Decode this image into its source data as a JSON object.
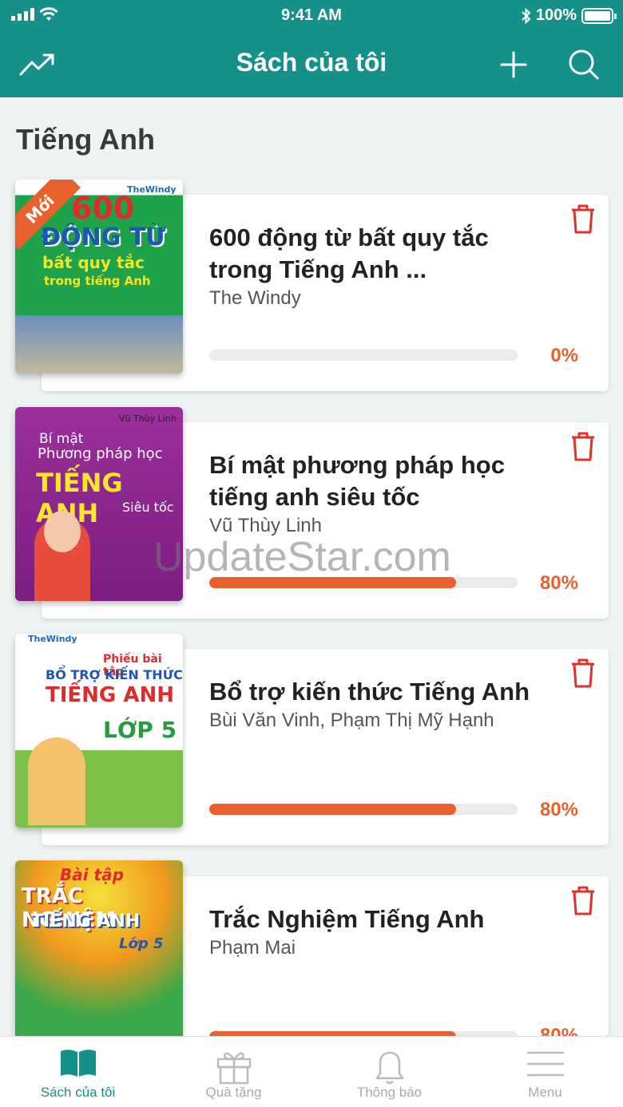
{
  "status": {
    "time": "9:41 AM",
    "battery": "100%"
  },
  "nav": {
    "title": "Sách của tôi"
  },
  "section": {
    "title": "Tiếng Anh"
  },
  "books": [
    {
      "title": "600 động từ bất quy tắc trong Tiếng Anh ...",
      "author": "The Windy",
      "progress": 0,
      "progress_label": "0%",
      "badge": "Mới",
      "cover": {
        "line1": "600",
        "line2": "ĐỘNG TỪ",
        "line3": "bất quy tắc",
        "line4": "trong tiếng Anh",
        "publisher": "TheWindy"
      }
    },
    {
      "title": "Bí mật phương pháp học tiếng anh siêu tốc",
      "author": "Vũ Thùy Linh",
      "progress": 0.8,
      "progress_label": "80%",
      "cover": {
        "line1": "Bí mật",
        "line2": "Phương pháp học",
        "line3": "TIẾNG ANH",
        "line4": "Siêu tốc",
        "publisher": "Vũ Thùy Linh"
      }
    },
    {
      "title": "Bổ trợ kiến thức Tiếng Anh",
      "author": "Bùi Văn Vinh, Phạm Thị Mỹ Hạnh",
      "progress": 0.8,
      "progress_label": "80%",
      "cover": {
        "line1": "Phiếu bài tập",
        "line2": "BỔ TRỢ KIẾN THỨC",
        "line3": "TIẾNG ANH",
        "line4": "LỚP 5",
        "publisher": "TheWindy"
      }
    },
    {
      "title": "Trắc Nghiệm Tiếng Anh",
      "author": "Phạm Mai",
      "progress": 0.8,
      "progress_label": "80%",
      "cover": {
        "line1": "Bài tập",
        "line2": "TRẮC NGHIỆM",
        "line3": "TIẾNG ANH",
        "line4": "Lớp 5"
      }
    }
  ],
  "watermark": "UpdateStar.com",
  "tabs": [
    {
      "label": "Sách của tôi",
      "icon": "book-icon"
    },
    {
      "label": "Quà tặng",
      "icon": "gift-icon"
    },
    {
      "label": "Thông báo",
      "icon": "bell-icon"
    },
    {
      "label": "Menu",
      "icon": "menu-icon"
    }
  ],
  "colors": {
    "primary": "#16918a",
    "accent": "#e8612c",
    "trash": "#e0312b"
  }
}
